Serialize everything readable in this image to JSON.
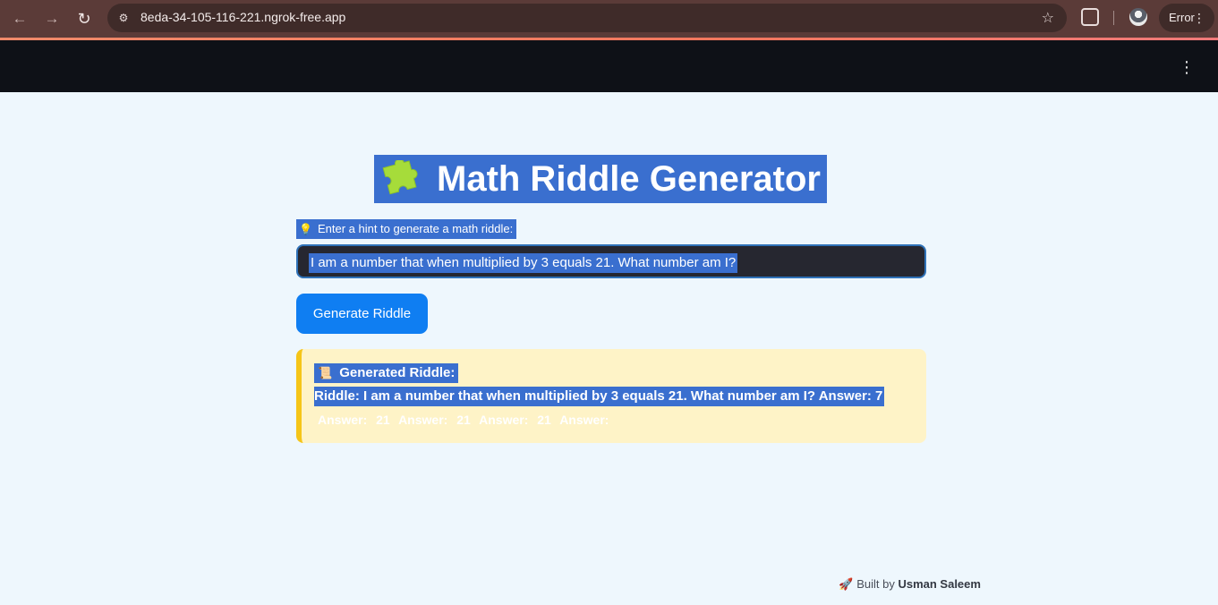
{
  "browser": {
    "url": "8eda-34-105-116-221.ngrok-free.app",
    "error_label": "Error",
    "back_glyph": "←",
    "forward_glyph": "→",
    "reload_glyph": "↻",
    "site_info_glyph": "⚙",
    "star_glyph": "☆",
    "menu_glyph": "⋮"
  },
  "app_header": {
    "menu_glyph": "⋮"
  },
  "page": {
    "title": "Math Riddle Generator",
    "hint_label": "Enter a hint to generate a math riddle:",
    "hint_icon": "💡",
    "input_value": "I am a number that when multiplied by 3 equals 21. What number am I?",
    "button_label": "Generate Riddle",
    "result_icon": "📜",
    "result_heading": "Generated Riddle:",
    "result_text": "Riddle: I am a number that when multiplied by 3 equals 21. What number am I? Answer: 7",
    "result_extra": "Answer: 21 Answer: 21 Answer: 21 Answer:"
  },
  "footer": {
    "rocket_icon": "🚀",
    "prefix": "Built by",
    "author": "Usman Saleem"
  },
  "colors": {
    "app_background": "#eef7fd",
    "header": "#0e1117",
    "selection": "#3a6fcf",
    "button": "#0f7ef2",
    "result_background": "#fef3c7",
    "result_border": "#f5c518",
    "input_background": "#262730"
  },
  "icons": [
    "puzzle-icon",
    "lightbulb-icon",
    "scroll-icon",
    "rocket-icon",
    "kebab-menu-icon",
    "star-icon",
    "extensions-icon",
    "profile-avatar"
  ]
}
